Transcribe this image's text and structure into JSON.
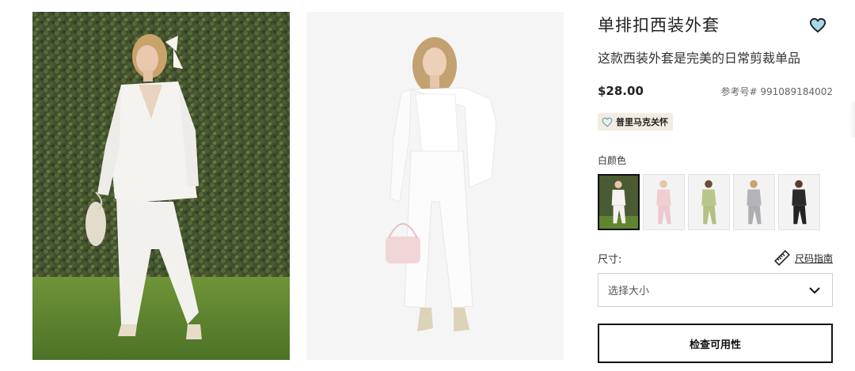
{
  "gallery": {
    "images": [
      {
        "name": "model-outdoor-photo"
      },
      {
        "name": "model-studio-photo"
      }
    ]
  },
  "product": {
    "title": "单排扣西装外套",
    "subtitle": "这款西装外套是完美的日常剪裁单品",
    "price": "$28.00",
    "reference": "参考号# 991089184002",
    "badge": {
      "label": "普里马克关怀",
      "icon": "heart-outline-icon"
    },
    "favorite_icon": "heart-icon",
    "color": {
      "label": "白颜色",
      "swatches": [
        {
          "name": "white",
          "selected": true
        },
        {
          "name": "pink",
          "selected": false
        },
        {
          "name": "green",
          "selected": false
        },
        {
          "name": "grey",
          "selected": false
        },
        {
          "name": "black",
          "selected": false
        }
      ]
    },
    "size": {
      "label": "尺寸:",
      "guide_label": "尺码指南",
      "guide_icon": "ruler-icon",
      "select_placeholder": "选择大小",
      "select_icon": "chevron-down-icon"
    },
    "check_button": "检查可用性"
  },
  "colors": {
    "accent_heart": "#a8d8ea",
    "badge_bg": "#f3ede1",
    "text": "#222222"
  }
}
